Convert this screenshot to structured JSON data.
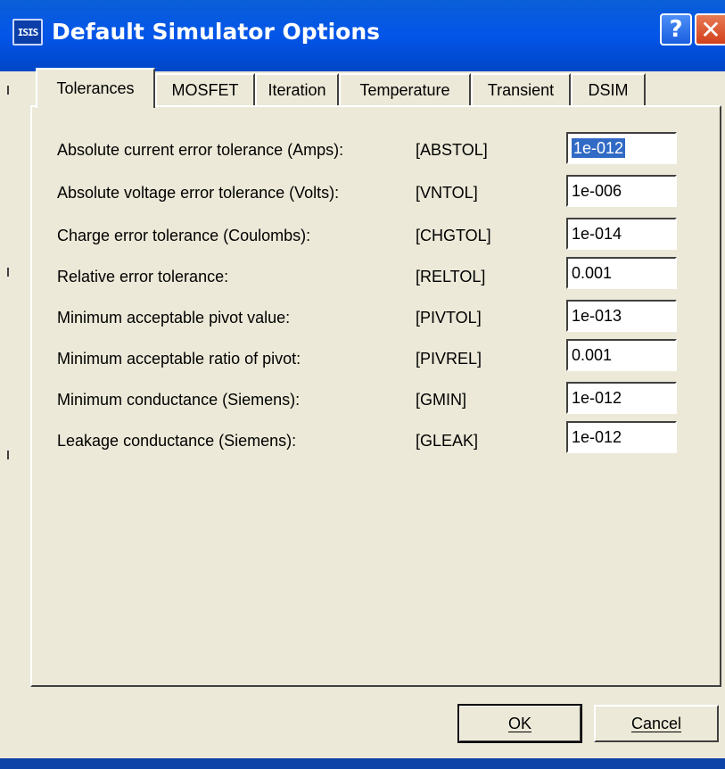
{
  "window": {
    "title": "Default Simulator Options",
    "app_icon_text": "ISIS",
    "help_label": "?",
    "close_label": "✕"
  },
  "tabs": [
    {
      "label": "Tolerances",
      "active": true
    },
    {
      "label": "MOSFET",
      "active": false
    },
    {
      "label": "Iteration",
      "active": false
    },
    {
      "label": "Temperature",
      "active": false
    },
    {
      "label": "Transient",
      "active": false
    },
    {
      "label": "DSIM",
      "active": false
    }
  ],
  "rows": [
    {
      "label": "Absolute current error tolerance (Amps):",
      "param": "[ABSTOL]",
      "value": "1e-012",
      "selected": true
    },
    {
      "label": "Absolute voltage error tolerance (Volts):",
      "param": "[VNTOL]",
      "value": "1e-006"
    },
    {
      "label": "Charge error tolerance (Coulombs):",
      "param": "[CHGTOL]",
      "value": "1e-014"
    },
    {
      "label": "Relative error tolerance:",
      "param": "[RELTOL]",
      "value": "0.001"
    },
    {
      "label": "Minimum acceptable pivot value:",
      "param": "[PIVTOL]",
      "value": "1e-013"
    },
    {
      "label": "Minimum acceptable ratio of pivot:",
      "param": "[PIVREL]",
      "value": "0.001"
    },
    {
      "label": "Minimum conductance (Siemens):",
      "param": "[GMIN]",
      "value": "1e-012"
    },
    {
      "label": "Leakage conductance (Siemens):",
      "param": "[GLEAK]",
      "value": "1e-012"
    }
  ],
  "buttons": {
    "ok_label": "OK",
    "cancel_label": "Cancel"
  },
  "colors": {
    "titlebar": "#0355e8",
    "dialog_face": "#ece9d8",
    "selection": "#316ac5",
    "close": "#d1411b"
  }
}
